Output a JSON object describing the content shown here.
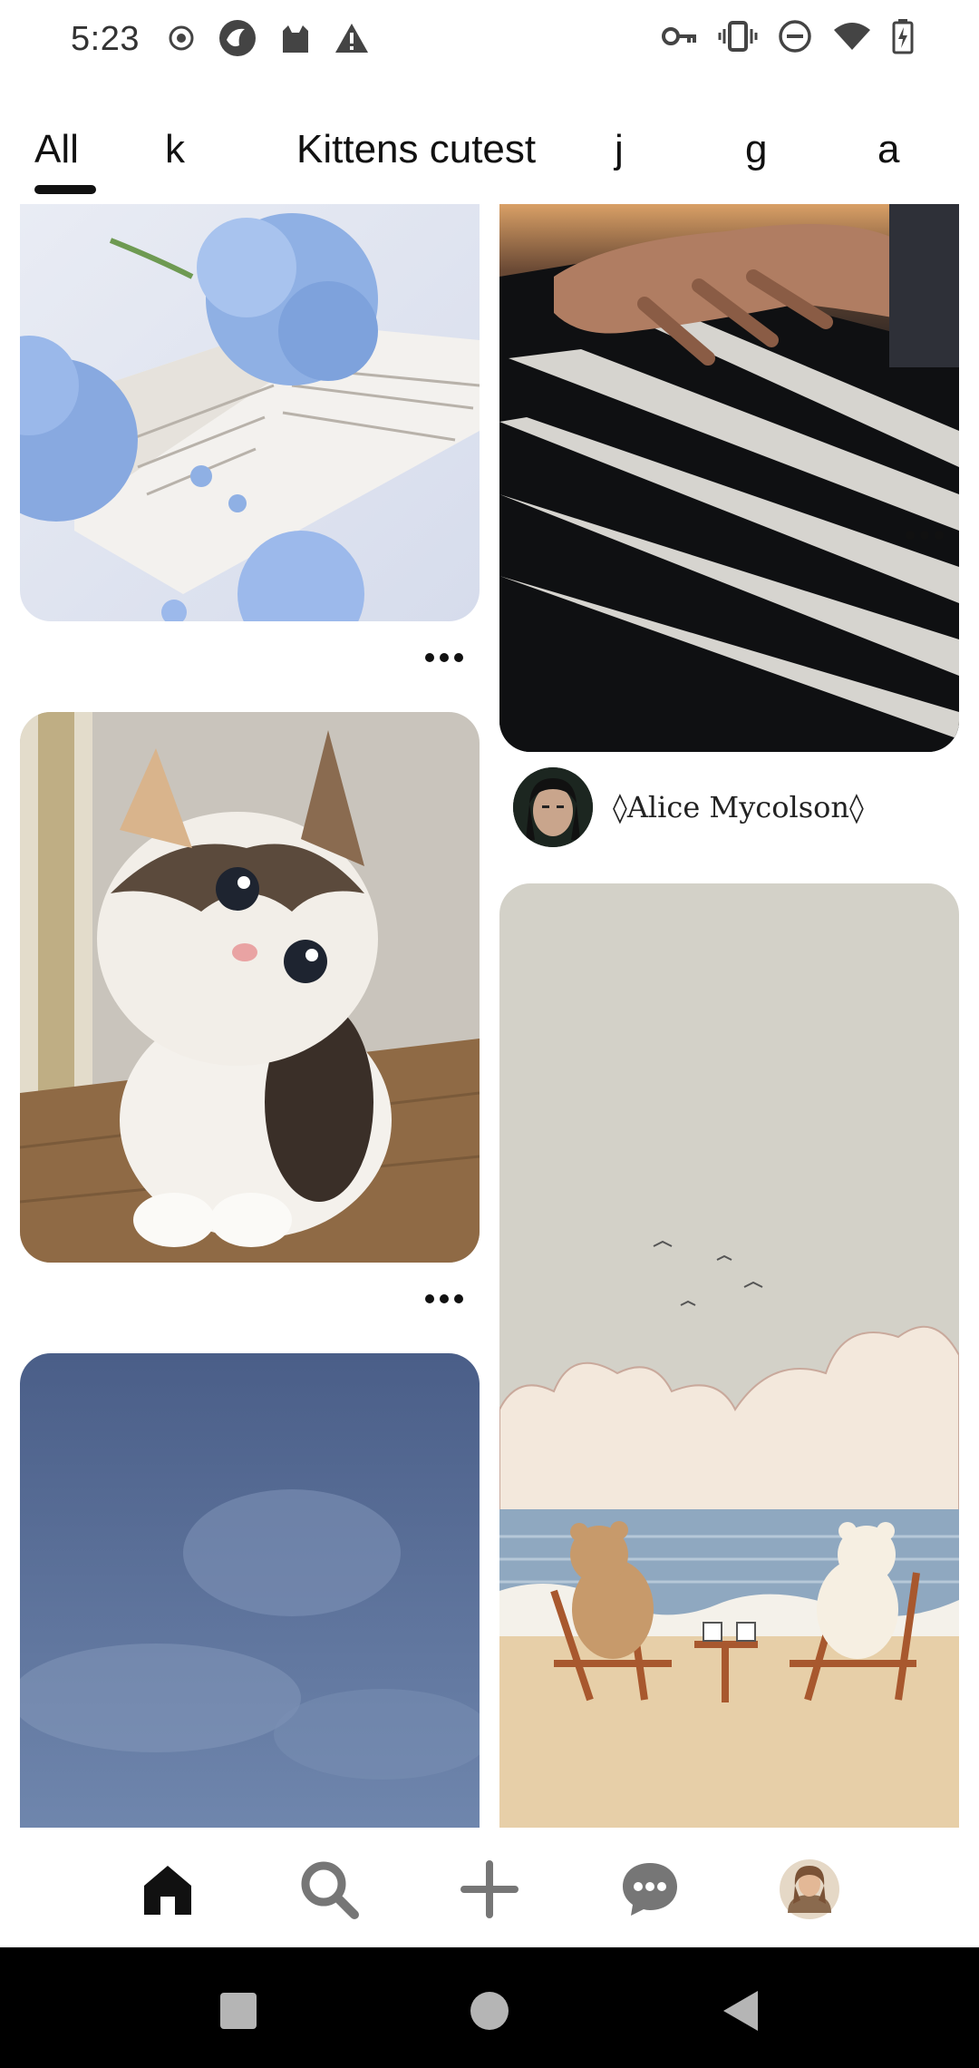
{
  "status_bar": {
    "time": "5:23",
    "left_icons": [
      "record-icon",
      "app-icon",
      "cat-icon",
      "alert-icon"
    ],
    "right_icons": [
      "vpn-key-icon",
      "vibrate-icon",
      "dnd-icon",
      "wifi-icon",
      "battery-charging-icon"
    ]
  },
  "tabs": [
    {
      "label": "All",
      "selected": true
    },
    {
      "label": "k",
      "selected": false
    },
    {
      "label": "Kittens cutest",
      "selected": false
    },
    {
      "label": "j",
      "selected": false
    },
    {
      "label": "g",
      "selected": false
    },
    {
      "label": "a",
      "selected": false
    }
  ],
  "feed": {
    "pins": [
      {
        "name": "hydrangea-book-pin",
        "image": "blue hydrangea on open book"
      },
      {
        "name": "piano-pin",
        "image": "hand on piano keys"
      },
      {
        "name": "kitten-pin",
        "image": "calico kitten"
      },
      {
        "name": "beach-bears-pin",
        "image": "bears in deck chairs at beach"
      },
      {
        "name": "sky-pin",
        "image": "cloudy blue sky"
      }
    ],
    "creator": {
      "name": "◊Alice Mycolson◊"
    }
  },
  "bottom_nav": {
    "items": [
      "home-icon",
      "search-icon",
      "create-icon",
      "messages-icon",
      "profile-avatar"
    ],
    "active": "home-icon"
  },
  "colors": {
    "accent": "#111111",
    "background": "#ffffff",
    "inactive_icon": "#767676"
  }
}
